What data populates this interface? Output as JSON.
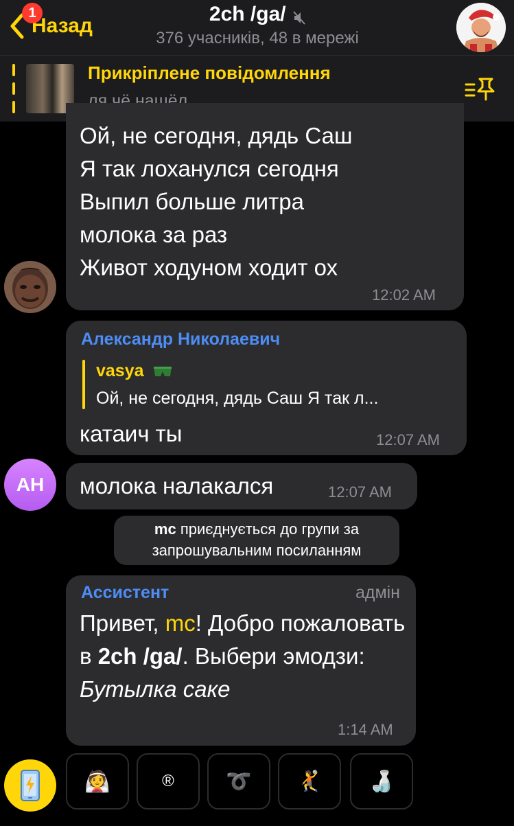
{
  "header": {
    "back_label": "Назад",
    "badge_count": "1",
    "title": "2ch /ga/",
    "subtitle": "376 учасників, 48 в мережі"
  },
  "pinned": {
    "title": "Прикріплене повідомлення",
    "text": "ля чё нашёл"
  },
  "messages": [
    {
      "text": "Ой, не сегодня, дядь Саш\nЯ так лоханулся сегодня\nВыпил больше литра\nмолока за раз\nЖивот ходуном ходит ох",
      "time": "12:02 AM"
    },
    {
      "sender": "Александр Николаевич",
      "reply_sender": "vasya",
      "reply_text": "Ой, не сегодня, дядь Саш Я так л...",
      "text": "катаич ты",
      "time": "12:07 AM"
    },
    {
      "avatar_initials": "AH",
      "text": "молока налакался",
      "time": "12:07 AM"
    }
  ],
  "service_message": {
    "user": "mc",
    "line1_rest": " приєднується до групи за",
    "line2": "запрошувальним посиланням"
  },
  "welcome_message": {
    "sender": "Ассистент",
    "role": "адмін",
    "part1": "Привет, ",
    "mention": "mc",
    "part2": "! Добро пожаловать в ",
    "group": "2ch /ga/",
    "part3": ". Выбери эмодзи: ",
    "emoji_name": "Бутылка саке",
    "time": "1:14 AM"
  },
  "keyboard": {
    "buttons": [
      {
        "label": "👰",
        "icon": "bride-emoji"
      },
      {
        "label": "®",
        "icon": "registered-sign"
      },
      {
        "label": "➰",
        "icon": "curly-loop"
      },
      {
        "label": "🤾",
        "icon": "handball-player-emoji"
      },
      {
        "label": "🍶",
        "icon": "sake-bottle-emoji"
      }
    ]
  },
  "colors": {
    "accent": "#ffd60a",
    "link_name": "#4d8df5",
    "bubble": "#2c2c2e",
    "background": "#000000",
    "avatar_ah": "#c46cf7"
  }
}
